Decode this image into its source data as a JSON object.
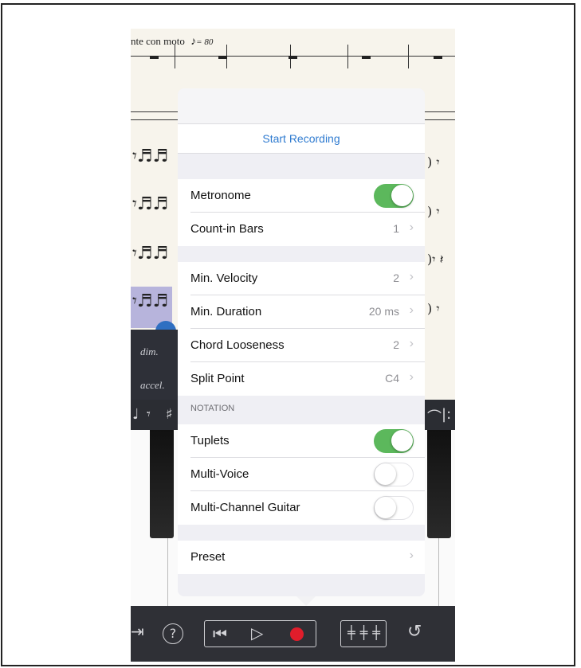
{
  "score": {
    "tempo_text": "nte con moto",
    "tempo_value": "= 80",
    "dynamics": [
      "dim.",
      "accel."
    ]
  },
  "popover": {
    "start_recording": "Start Recording",
    "settings": [
      {
        "label": "Metronome",
        "type": "toggle",
        "on": true
      },
      {
        "label": "Count-in Bars",
        "value": "1"
      }
    ],
    "filters": [
      {
        "label": "Min. Velocity",
        "value": "2"
      },
      {
        "label": "Min. Duration",
        "value": "20 ms"
      },
      {
        "label": "Chord Looseness",
        "value": "2"
      },
      {
        "label": "Split Point",
        "value": "C4"
      }
    ],
    "notation_header": "NOTATION",
    "notation": [
      {
        "label": "Tuplets",
        "on": true
      },
      {
        "label": "Multi-Voice",
        "on": false
      },
      {
        "label": "Multi-Channel Guitar",
        "on": false
      }
    ],
    "preset_label": "Preset"
  },
  "toolbar": {
    "help_icon": "question-circle-icon",
    "rewind_icon": "rewind-to-start-icon",
    "play_icon": "play-icon",
    "record_icon": "record-icon",
    "record_color": "#e01d2b",
    "mixer_icon": "mixer-sliders-icon",
    "undo_icon": "undo-icon"
  },
  "colors": {
    "toggle_on": "#5cb85c",
    "link_blue": "#2f7bd0"
  }
}
